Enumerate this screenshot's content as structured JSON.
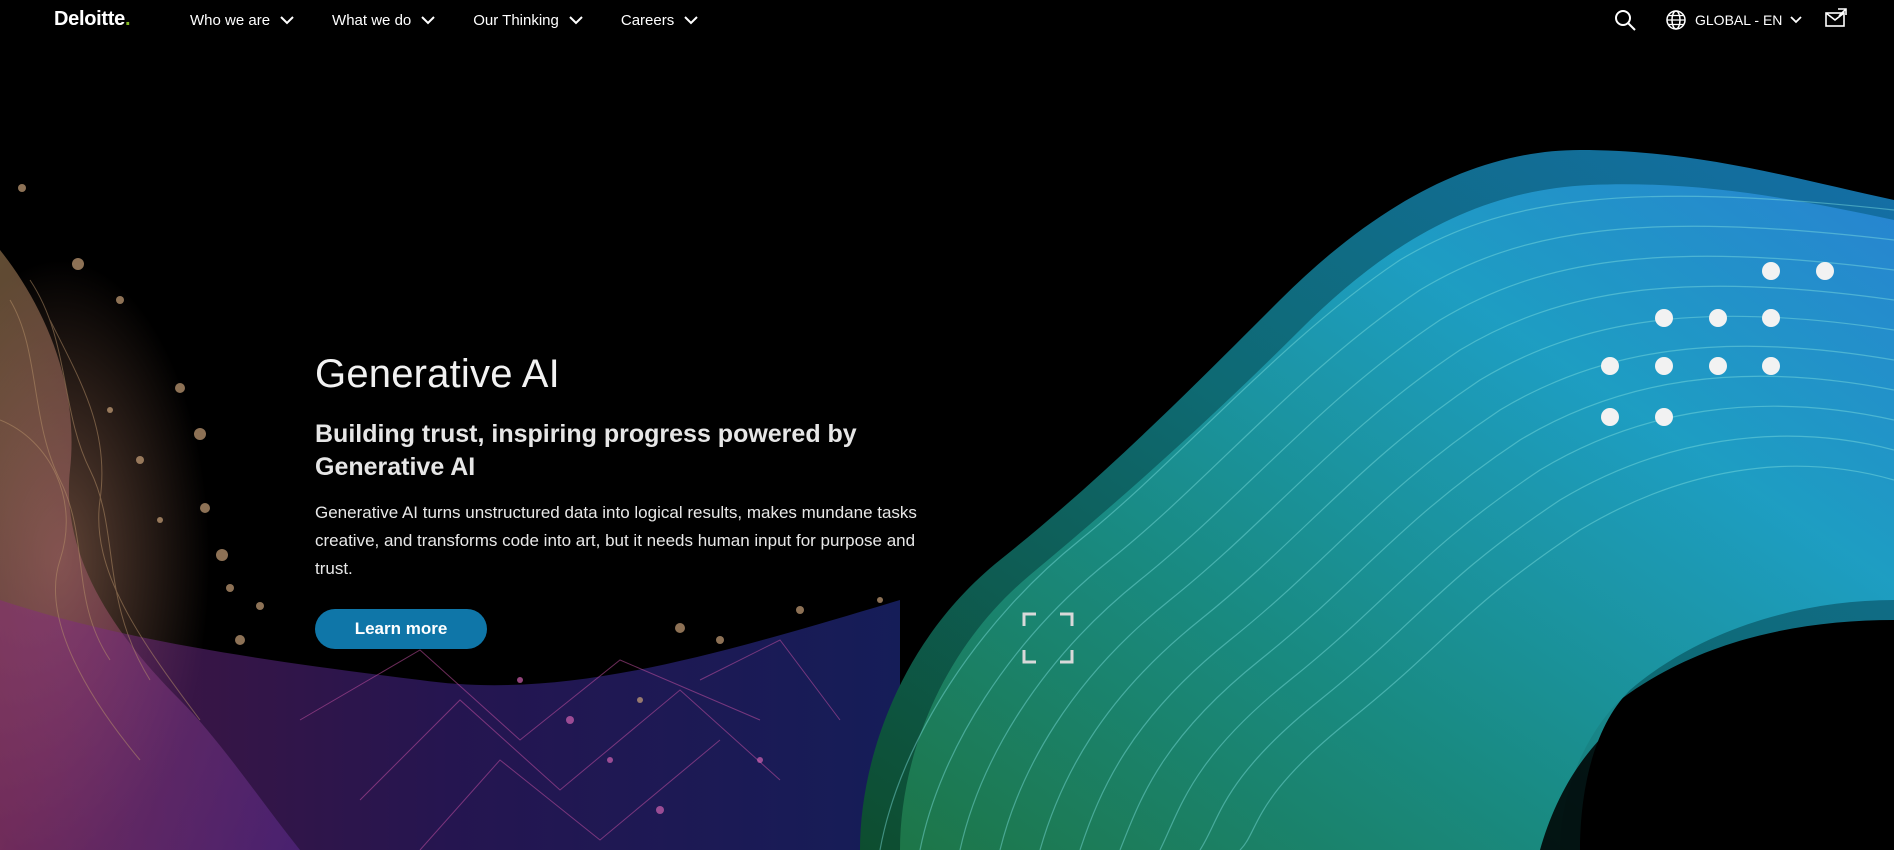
{
  "brand": {
    "name": "Deloitte",
    "dot": ".",
    "accent_color": "#86bc25"
  },
  "nav": {
    "items": [
      {
        "label": "Who we are"
      },
      {
        "label": "What we do"
      },
      {
        "label": "Our Thinking"
      },
      {
        "label": "Careers"
      }
    ]
  },
  "header_actions": {
    "search_icon": "search-icon",
    "locale_label": "GLOBAL - EN",
    "globe_icon": "globe-icon",
    "contact_icon": "contact-icon"
  },
  "hero": {
    "eyebrow": "Generative AI",
    "title": "Building trust, inspiring progress powered by Generative AI",
    "description": "Generative AI turns unstructured data into logical results, makes mundane tasks creative, and transforms code into art, but it needs human input for purpose and trust.",
    "cta_label": "Learn more",
    "cta_color": "#0f76a8",
    "expand_icon": "expand-icon"
  }
}
